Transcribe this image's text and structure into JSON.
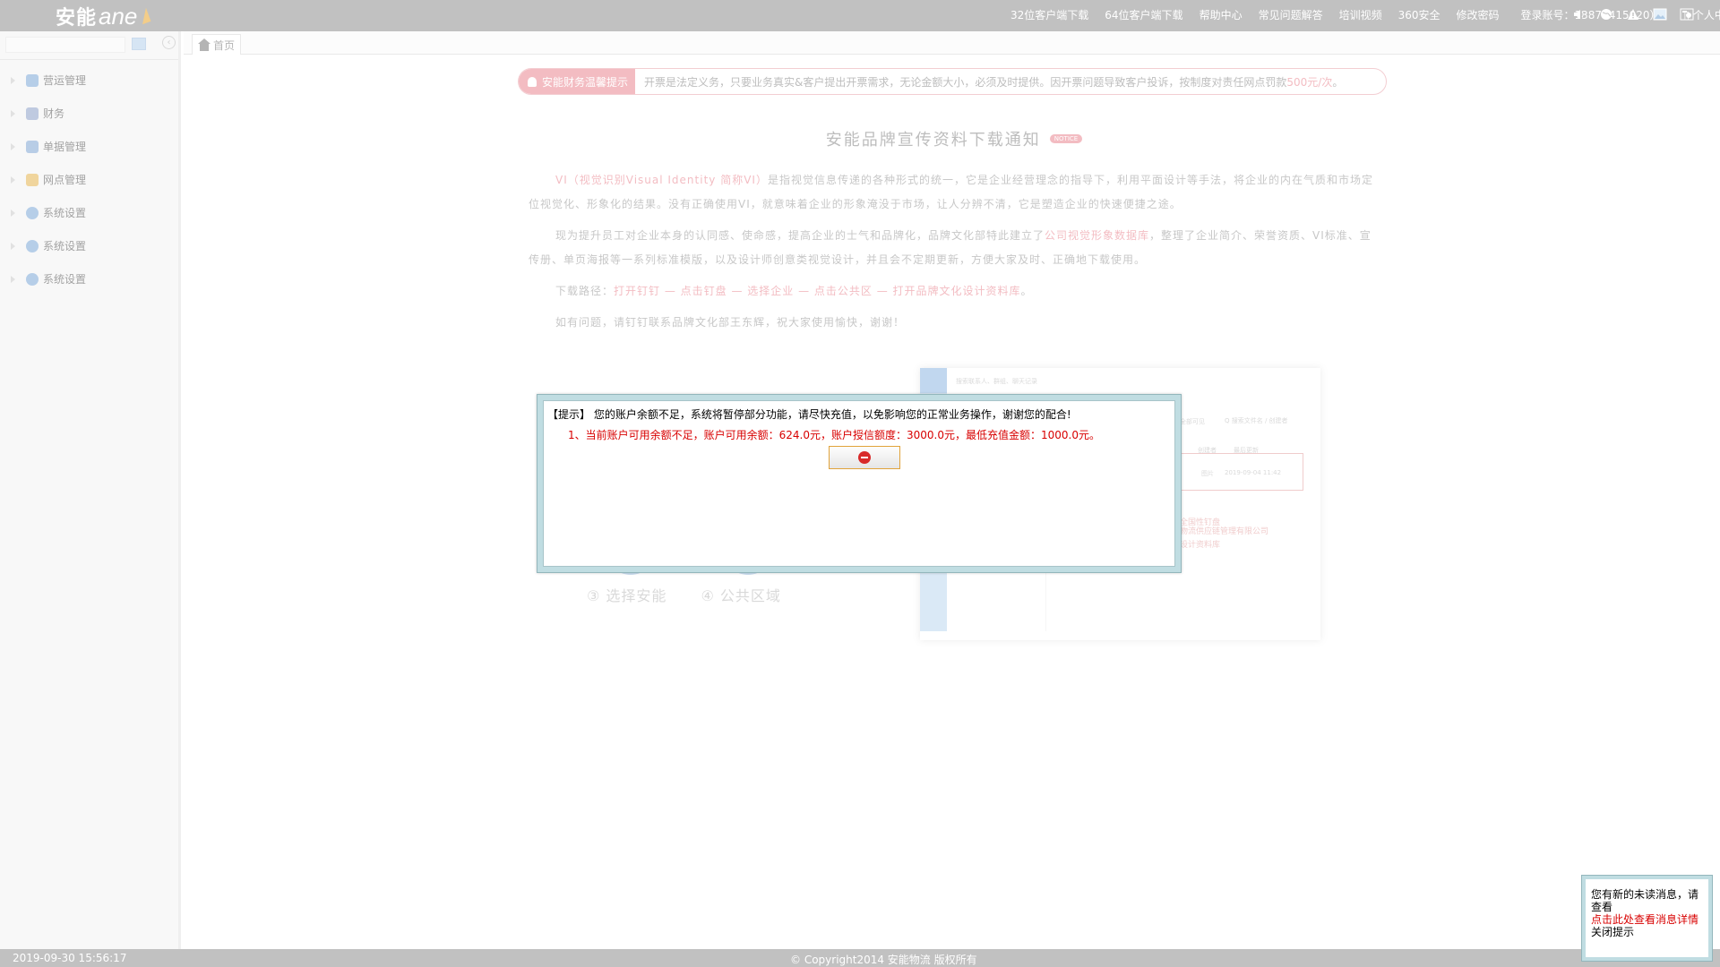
{
  "header": {
    "logo_text": "安能",
    "logo_en": "ane",
    "nav_links": [
      "32位客户端下载",
      "64位客户端下载",
      "帮助中心",
      "常见问题解答",
      "培训视频",
      "360安全",
      "修改密码"
    ],
    "user_info": "登录账号：13876415020）",
    "user_menu": "▯ 个人中心 ▯",
    "icons": [
      "speaker-icon",
      "globe-icon",
      "warning-icon",
      "image-icon",
      "settings-icon"
    ]
  },
  "sidebar": {
    "search_placeholder": "",
    "collapse_label": "‹",
    "items": [
      {
        "label": "营运管理",
        "icon": "operations-icon",
        "color": "#7aa6d6"
      },
      {
        "label": "财务",
        "icon": "finance-icon",
        "color": "#8b9fc6"
      },
      {
        "label": "单据管理",
        "icon": "document-icon",
        "color": "#7fa5d2"
      },
      {
        "label": "网点管理",
        "icon": "home-icon",
        "color": "#e3b24e"
      },
      {
        "label": "系统设置",
        "icon": "settings-icon",
        "color": "#7aa6d6"
      },
      {
        "label": "系统设置",
        "icon": "settings-icon",
        "color": "#7aa6d6"
      },
      {
        "label": "系统设置",
        "icon": "settings-icon",
        "color": "#7aa6d6"
      }
    ]
  },
  "tabs": [
    {
      "label": "首页"
    }
  ],
  "notice": {
    "badge": "安能财务温馨提示",
    "text": "开票是法定义务，只要业务真实&客户提出开票需求，无论金额大小，必须及时提供。因开票问题导致客户投诉，按制度对责任网点罚款",
    "penalty": "500元/次",
    "end": "。"
  },
  "article": {
    "title": "安能品牌宣传资料下载通知",
    "tag": "NOTICE",
    "p1_pink": "VI（视觉识别Visual Identity 简称VI）",
    "p1_rest": "是指视觉信息传递的各种形式的统一，它是企业经营理念的指导下，利用平面设计等手法，将企业的内在气质和市场定位视觉化、形象化的结果。没有正确使用VI，就意味着企业的形象淹没于市场，让人分辨不清，它是塑造企业的快速便捷之途。",
    "p2_a": "现为提升员工对企业本身的认同感、使命感，提高企业的士气和品牌化，品牌文化部特此建立了",
    "p2_pink": "公司视觉形象数据库",
    "p2_b": "，整理了企业简介、荣誉资质、VI标准、宣传册、单页海报等一系列标准模版，以及设计师创意类视觉设计，并且会不定期更新，方便大家及时、正确地下载使用。",
    "p3_label": "下载路径：",
    "p3_path": "打开钉钉 — 点击钉盘 — 选择企业 — 点击公共区 — 打开品牌文化设计资料库",
    "p3_end": "。",
    "p4": "如有问题，请钉钉联系品牌文化部王东辉，祝大家使用愉快，谢谢！"
  },
  "graphic": {
    "steps": [
      "③ 选择安能",
      "④ 公共区域"
    ],
    "search_hint": "搜索联系人、群组、聊天记录",
    "search2": "Q 搜索文件名 / 创建者",
    "tab": "全部可见",
    "col1": "创建者",
    "col2": "最后更新",
    "row_a": "图片",
    "row_b": "2019-09-04 11:42",
    "red1": "全国性钉盘",
    "red2": "物流供应链管理有限公司",
    "red3": "设计资料库"
  },
  "dialog": {
    "title": "【提示】 您的账户余额不足，系统将暂停部分功能，请尽快充值，以免影响您的正常业务操作，谢谢您的配合!",
    "message": "1、当前账户可用余额不足，账户可用余额：624.0元，账户授信额度：3000.0元，最低充值金额：1000.0元。",
    "button_icon": "stop-icon"
  },
  "status": {
    "timestamp": "2019-09-30 15:56:17",
    "copyright": "© Copyright2014 安能物流 版权所有"
  },
  "popup": {
    "line1": "您有新的未读消息，请查看",
    "line2": "点击此处查看消息详情",
    "line3": "关闭提示"
  }
}
